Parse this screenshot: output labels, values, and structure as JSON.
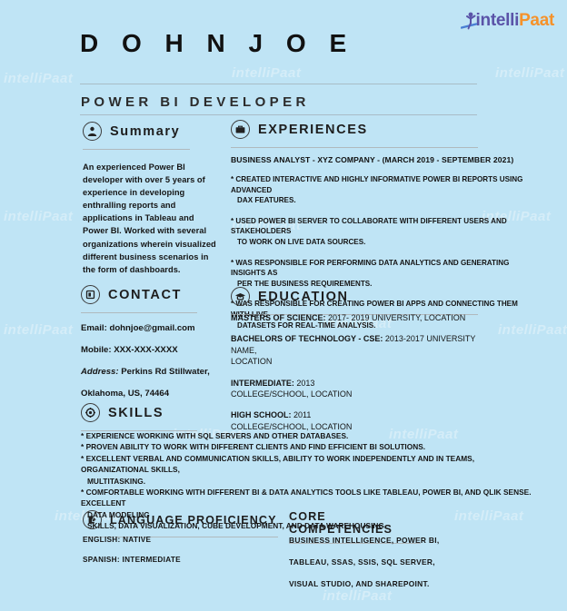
{
  "brand": {
    "logo_text_1": "intelli",
    "logo_text_2": "Paat",
    "purple": "#5a53a8",
    "orange": "#f5922a",
    "watermark_text": "intelliPaat"
  },
  "theme": {
    "background": "#bfe4f5",
    "text": "#151515",
    "rule": "#a9bcc6"
  },
  "header": {
    "name": "D O H N   J O E",
    "role": "POWER BI DEVELOPER"
  },
  "summary": {
    "title": "Summary",
    "icon": "person-icon",
    "body": "An experienced Power BI developer with over 5 years of experience in developing enthralling reports and applications in Tableau and Power BI. Worked with several organizations wherein visualized different business scenarios in the form of dashboards."
  },
  "contact": {
    "title": "CONTACT",
    "icon": "contact-card-icon",
    "email": "Email: dohnjoe@gmail.com",
    "mobile": "Mobile: XXX-XXX-XXXX",
    "address_label": "Address:",
    "address_line1": "Perkins Rd Stillwater,",
    "address_line2": "Oklahoma, US, 74464"
  },
  "skills": {
    "title": "SKILLS",
    "icon": "gear-target-icon",
    "items": [
      {
        "text": "* EXPERIENCE WORKING WITH SQL SERVERS AND OTHER DATABASES.",
        "cont": ""
      },
      {
        "text": "* PROVEN ABILITY TO WORK WITH DIFFERENT CLIENTS AND FIND EFFICIENT BI SOLUTIONS.",
        "cont": ""
      },
      {
        "text": "* EXCELLENT VERBAL AND COMMUNICATION SKILLS, ABILITY TO WORK INDEPENDENTLY AND IN TEAMS, ORGANIZATIONAL SKILLS,",
        "cont": "MULTITASKING."
      },
      {
        "text": "* COMFORTABLE WORKING WITH DIFFERENT BI & DATA ANALYTICS TOOLS LIKE TABLEAU, POWER BI, AND QLIK SENSE. EXCELLENT",
        "cont": "DATA MODELING"
      },
      {
        "text": "",
        "cont": "SKILLS, DATA VISUALIZATION, CUBE DEVELOPMENT, AND DATA WAREHOUSING."
      }
    ]
  },
  "experiences": {
    "title": "EXPERIENCES",
    "icon": "briefcase-icon",
    "job_title": "BUSINESS ANALYST - XYZ COMPANY - (MARCH 2019 - SEPTEMBER 2021)",
    "bullets": [
      {
        "text": "* CREATED INTERACTIVE AND HIGHLY INFORMATIVE POWER BI REPORTS USING ADVANCED",
        "cont": "DAX FEATURES."
      },
      {
        "text": "* USED POWER BI SERVER TO COLLABORATE WITH DIFFERENT USERS AND STAKEHOLDERS",
        "cont": "TO WORK ON LIVE DATA SOURCES."
      },
      {
        "text": "* WAS RESPONSIBLE FOR PERFORMING DATA ANALYTICS AND GENERATING INSIGHTS AS",
        "cont": "PER THE BUSINESS REQUIREMENTS."
      },
      {
        "text": "* WAS RESPONSIBLE FOR CREATING POWER BI APPS AND CONNECTING THEM WITH LIVE",
        "cont": "DATASETS FOR REAL-TIME ANALYSIS."
      }
    ]
  },
  "education": {
    "title": "EDUCATION",
    "icon": "graduation-cap-icon",
    "items": [
      {
        "degree": "MASTERS OF SCIENCE:",
        "detail": " 2017- 2019 UNIVERSITY, LOCATION",
        "detail2": ""
      },
      {
        "degree": "BACHELORS OF TECHNOLOGY - CSE:",
        "detail": " 2013-2017 UNIVERSITY NAME,",
        "detail2": "LOCATION"
      },
      {
        "degree": "INTERMEDIATE:",
        "detail": " 2013",
        "detail2": "COLLEGE/SCHOOL, LOCATION"
      },
      {
        "degree": "HIGH SCHOOL:",
        "detail": " 2011",
        "detail2": "COLLEGE/SCHOOL, LOCATION"
      }
    ]
  },
  "language": {
    "title": "LANGUAGE PROFICIENCY",
    "icon": "document-pen-icon",
    "items": [
      "ENGLISH: NATIVE",
      "SPANISH: INTERMEDIATE"
    ]
  },
  "core": {
    "title": "CORE COMPETENCIES",
    "items": [
      "BUSINESS INTELLIGENCE, POWER BI,",
      "TABLEAU, SSAS, SSIS, SQL SERVER,",
      "VISUAL STUDIO, AND SHAREPOINT."
    ]
  }
}
